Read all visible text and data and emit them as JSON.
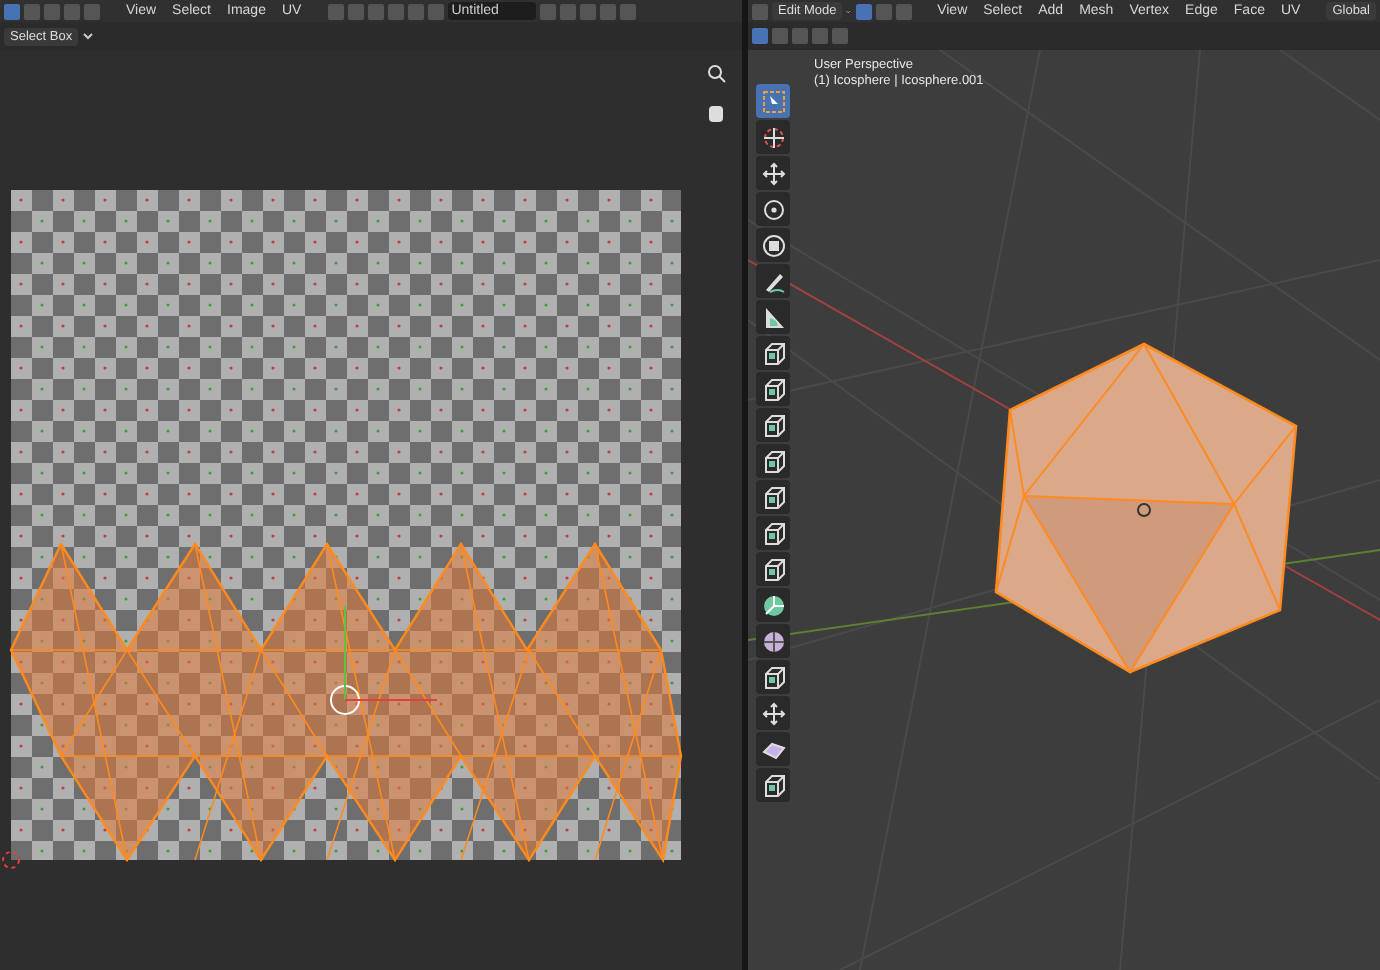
{
  "uv_editor": {
    "header": {
      "menus": [
        "View",
        "Select",
        "Image",
        "UV"
      ],
      "image_name": "Untitled"
    },
    "tool_settings": {
      "select_tool": "Select Box"
    }
  },
  "viewport": {
    "header": {
      "mode": "Edit Mode",
      "menus": [
        "View",
        "Select",
        "Add",
        "Mesh",
        "Vertex",
        "Edge",
        "Face",
        "UV"
      ],
      "orientation": "Global"
    },
    "overlay": {
      "view_name": "User Perspective",
      "object_info": "(1) Icosphere | Icosphere.001"
    },
    "toolbar": [
      {
        "kind": "select",
        "selected": true
      },
      {
        "kind": "cursor",
        "selected": false
      },
      {
        "kind": "move",
        "selected": false
      },
      {
        "kind": "rotate",
        "selected": false
      },
      {
        "kind": "scale",
        "selected": false
      },
      {
        "kind": "annotate",
        "selected": false
      },
      {
        "kind": "measure",
        "selected": false
      },
      {
        "kind": "cube",
        "selected": false
      },
      {
        "kind": "cube",
        "selected": false
      },
      {
        "kind": "cube",
        "selected": false
      },
      {
        "kind": "cube",
        "selected": false
      },
      {
        "kind": "cube",
        "selected": false
      },
      {
        "kind": "cube",
        "selected": false
      },
      {
        "kind": "cube",
        "selected": false
      },
      {
        "kind": "spin",
        "selected": false
      },
      {
        "kind": "sphere",
        "selected": false
      },
      {
        "kind": "cube",
        "selected": false
      },
      {
        "kind": "move",
        "selected": false
      },
      {
        "kind": "slab",
        "selected": false
      },
      {
        "kind": "cube",
        "selected": false
      }
    ]
  }
}
